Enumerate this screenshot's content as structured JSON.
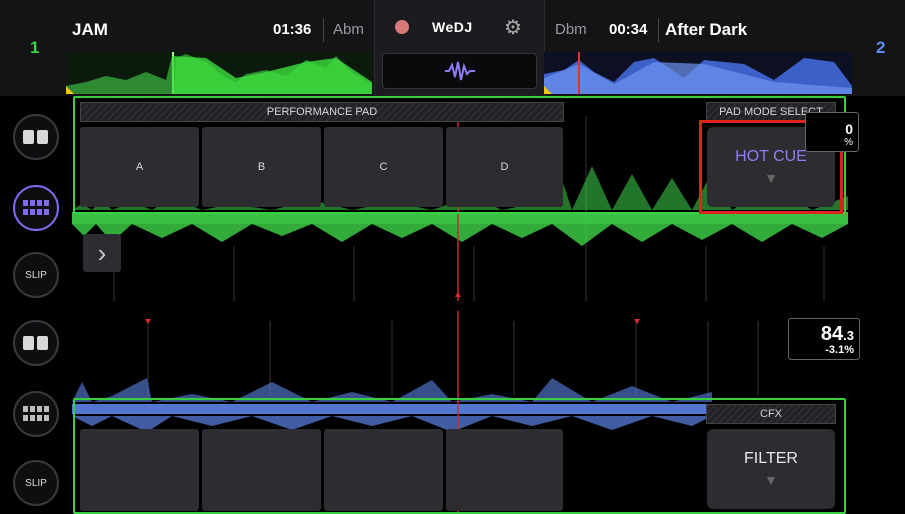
{
  "deck1": {
    "number": "1",
    "title": "JAM",
    "time": "01:36",
    "key": "Abm",
    "color": "#39d14a"
  },
  "deck2": {
    "number": "2",
    "title": "After Dark",
    "time": "00:34",
    "key": "Dbm",
    "color": "#5b8df5"
  },
  "center": {
    "logo": "WeDJ",
    "wave_icon": "waveform-icon",
    "record_icon": "record-icon",
    "settings_icon": "gear-icon"
  },
  "side_buttons": [
    "",
    "",
    "SLIP",
    "",
    "",
    "SLIP"
  ],
  "top_panel": {
    "label": "PERFORMANCE PAD",
    "mode_label": "PAD MODE SELECT",
    "pads": [
      "A",
      "B",
      "C",
      "D"
    ],
    "mode": "HOT CUE",
    "bpm_partial": "0",
    "pitch_partial": "%"
  },
  "bottom_panel": {
    "mode_label": "CFX",
    "pads": [
      "",
      "",
      "",
      ""
    ],
    "mode": "FILTER",
    "bpm_main": "84",
    "bpm_decimal": ".3",
    "pitch": "-3.1%"
  },
  "colors": {
    "accent": "#7d6cf0",
    "highlight": "#e0231b",
    "frame": "#37d042"
  }
}
